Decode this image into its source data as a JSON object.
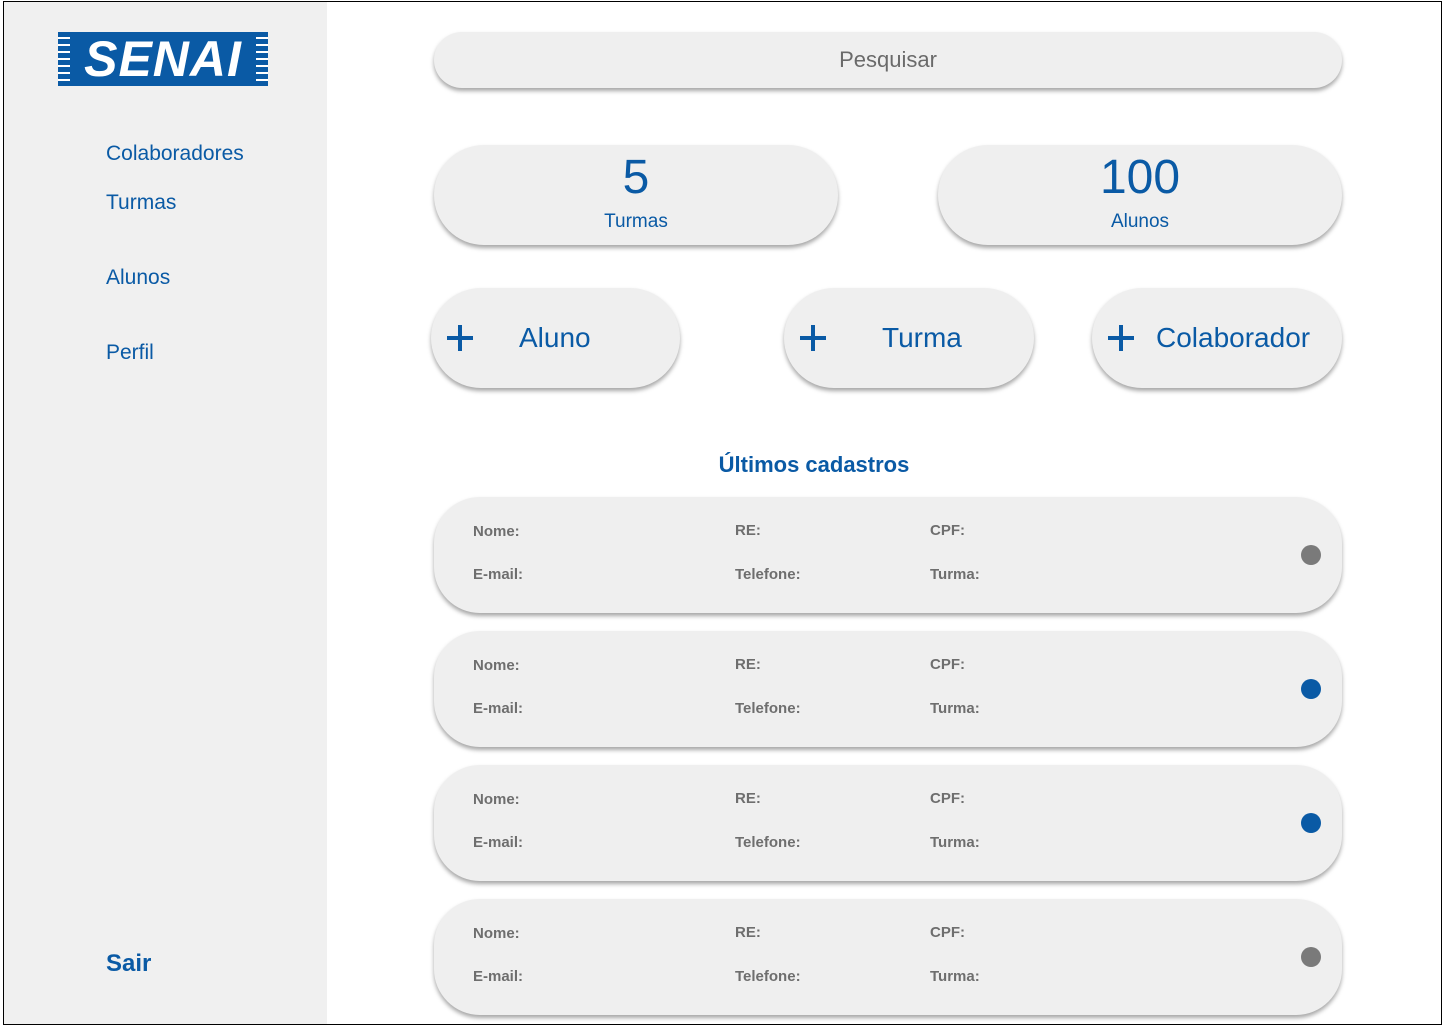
{
  "brand": {
    "logo_text": "SENAI"
  },
  "sidebar": {
    "items": [
      {
        "label": "Colaboradores"
      },
      {
        "label": "Turmas"
      },
      {
        "label": "Alunos"
      },
      {
        "label": "Perfil"
      }
    ],
    "logout_label": "Sair"
  },
  "search": {
    "placeholder": "Pesquisar"
  },
  "stats": [
    {
      "value": "5",
      "label": "Turmas"
    },
    {
      "value": "100",
      "label": "Alunos"
    }
  ],
  "actions": [
    {
      "icon": "plus-icon",
      "label": "Aluno"
    },
    {
      "icon": "plus-icon",
      "label": "Turma"
    },
    {
      "icon": "plus-icon",
      "label": "Colaborador"
    }
  ],
  "recent": {
    "title": "Últimos cadastros",
    "field_labels": {
      "nome": "Nome:",
      "re": "RE:",
      "cpf": "CPF:",
      "email": "E-mail:",
      "telefone": "Telefone:",
      "turma": "Turma:"
    },
    "records": [
      {
        "status_color": "#7a7a7a"
      },
      {
        "status_color": "#0a5aa5"
      },
      {
        "status_color": "#0a5aa5"
      },
      {
        "status_color": "#7a7a7a"
      }
    ]
  },
  "colors": {
    "accent": "#0a5aa5",
    "panel": "#efefef",
    "sidebar_bg": "#f0f0f0",
    "muted_text": "#6e6e6e"
  }
}
